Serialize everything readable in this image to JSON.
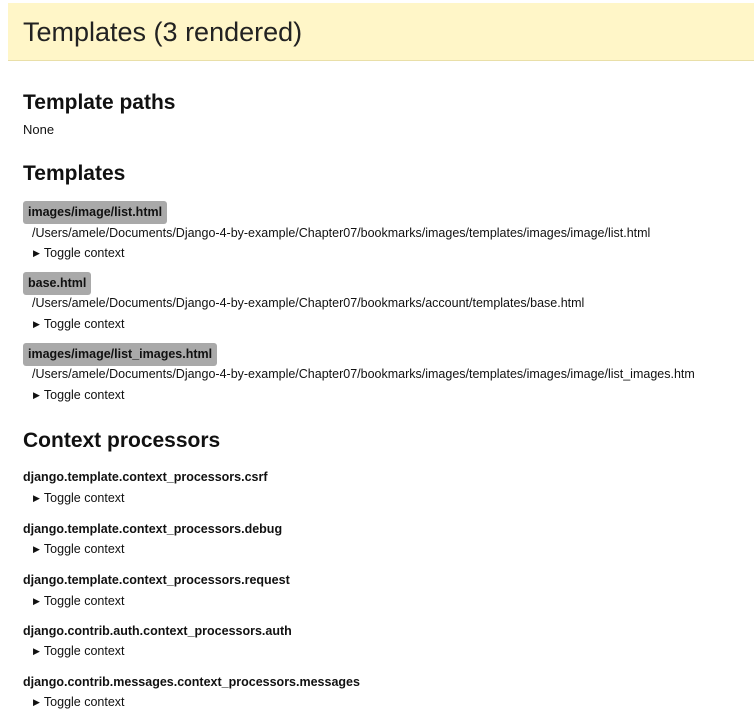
{
  "panel": {
    "title": "Templates (3 rendered)"
  },
  "template_paths": {
    "heading": "Template paths",
    "value": "None"
  },
  "templates": {
    "heading": "Templates",
    "items": [
      {
        "name": "images/image/list.html",
        "path": "/Users/amele/Documents/Django-4-by-example/Chapter07/bookmarks/images/templates/images/image/list.html",
        "toggle": "Toggle context"
      },
      {
        "name": "base.html",
        "path": "/Users/amele/Documents/Django-4-by-example/Chapter07/bookmarks/account/templates/base.html",
        "toggle": "Toggle context"
      },
      {
        "name": "images/image/list_images.html",
        "path": "/Users/amele/Documents/Django-4-by-example/Chapter07/bookmarks/images/templates/images/image/list_images.htm",
        "toggle": "Toggle context"
      }
    ]
  },
  "context_processors": {
    "heading": "Context processors",
    "items": [
      {
        "name": "django.template.context_processors.csrf",
        "toggle": "Toggle context"
      },
      {
        "name": "django.template.context_processors.debug",
        "toggle": "Toggle context"
      },
      {
        "name": "django.template.context_processors.request",
        "toggle": "Toggle context"
      },
      {
        "name": "django.contrib.auth.context_processors.auth",
        "toggle": "Toggle context"
      },
      {
        "name": "django.contrib.messages.context_processors.messages",
        "toggle": "Toggle context"
      }
    ]
  },
  "icons": {
    "toggle_arrow": "disclosure-triangle-icon"
  },
  "colors": {
    "header_background": "#fff6c8",
    "template_badge": "#a9a9a9"
  }
}
